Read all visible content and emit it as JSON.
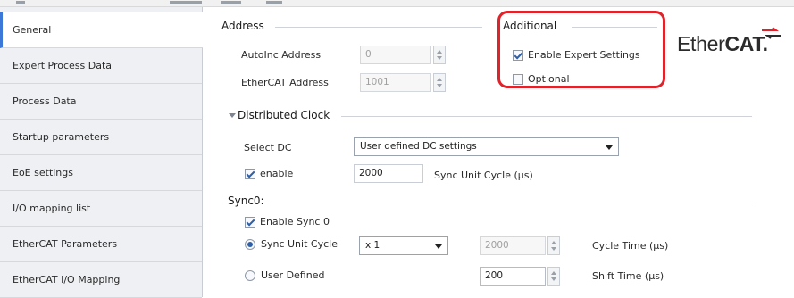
{
  "sidebar": {
    "items": [
      {
        "label": "General",
        "active": true
      },
      {
        "label": "Expert Process Data"
      },
      {
        "label": "Process Data"
      },
      {
        "label": "Startup parameters"
      },
      {
        "label": "EoE settings"
      },
      {
        "label": "I/O mapping list"
      },
      {
        "label": "EtherCAT Parameters"
      },
      {
        "label": "EtherCAT I/O Mapping"
      }
    ]
  },
  "address": {
    "title": "Address",
    "autoinc_label": "AutoInc Address",
    "autoinc_value": "0",
    "ethercat_label": "EtherCAT Address",
    "ethercat_value": "1001"
  },
  "additional": {
    "title": "Additional",
    "expert_label": "Enable Expert Settings",
    "expert_checked": true,
    "optional_label": "Optional",
    "optional_checked": false
  },
  "logo": {
    "light": "Ether",
    "bold": "CAT."
  },
  "dc": {
    "title": "Distributed Clock",
    "select_label": "Select DC",
    "select_value": "User defined DC settings",
    "enable_label": "enable",
    "enable_checked": true,
    "cycle_value": "2000",
    "cycle_unit_label": "Sync Unit Cycle (µs)"
  },
  "sync0": {
    "title": "Sync0:",
    "enable_label": "Enable Sync 0",
    "enable_checked": true,
    "sync_unit_label": "Sync Unit Cycle",
    "multiplier_value": "x 1",
    "cycle_time_value": "2000",
    "cycle_time_label": "Cycle Time (µs)",
    "user_defined_label": "User Defined",
    "shift_value": "200",
    "shift_label": "Shift Time (µs)"
  },
  "colors": {
    "highlight": "#e0232b",
    "accent": "#3c78d8"
  }
}
